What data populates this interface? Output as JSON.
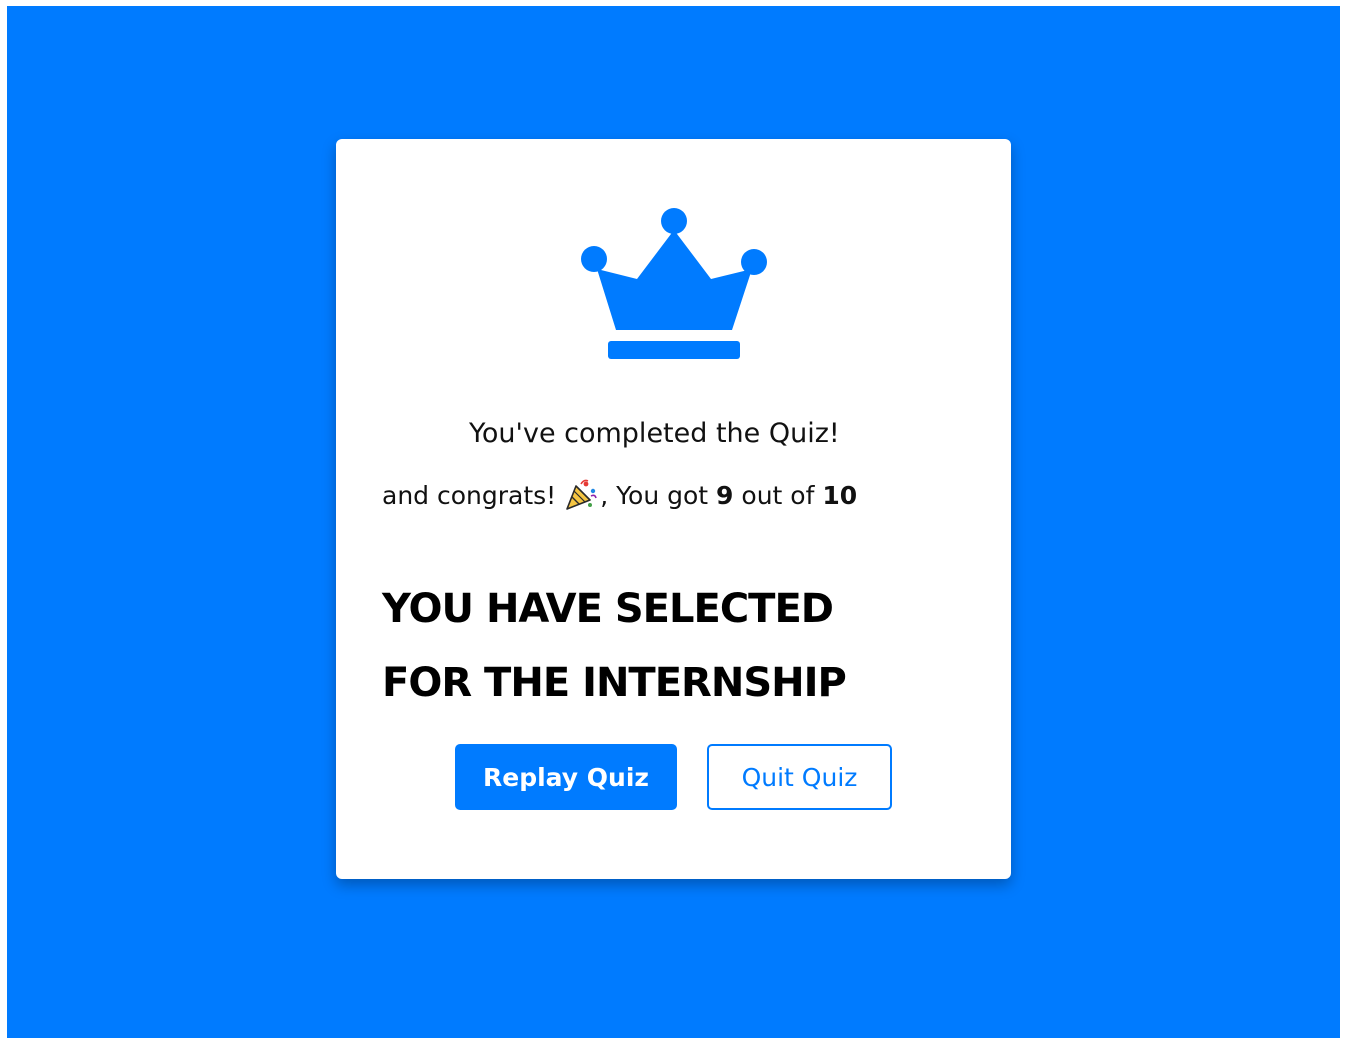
{
  "result": {
    "completed_text": "You've completed the Quiz!",
    "congrats_prefix": "and congrats!",
    "score_prefix": ", You got",
    "score": "9",
    "score_middle": "out of",
    "total": "10",
    "headline_line1": "YOU HAVE SELECTED",
    "headline_line2": "FOR THE INTERNSHIP"
  },
  "buttons": {
    "replay_label": "Replay Quiz",
    "quit_label": "Quit Quiz"
  },
  "icons": {
    "trophy": "crown-icon",
    "celebration": "party-popper-icon"
  },
  "colors": {
    "accent": "#007bff",
    "card": "#ffffff",
    "text": "#111111"
  }
}
